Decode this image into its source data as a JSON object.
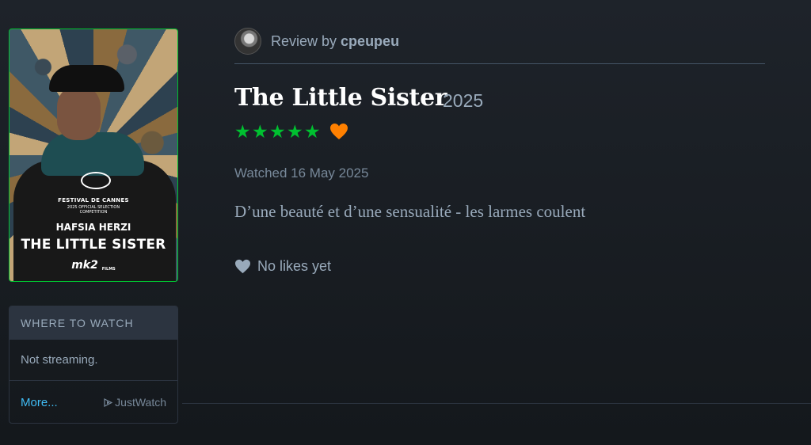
{
  "poster": {
    "festival": "FESTIVAL DE CANNES",
    "selection": "2025 OFFICIAL SELECTION",
    "competition": "COMPETITION",
    "director": "HAFSIA HERZI",
    "title": "THE LITTLE SISTER",
    "distributor": "mk2",
    "distributor_sub": "FILMS"
  },
  "where_to_watch": {
    "heading": "Where to watch",
    "status": "Not streaming.",
    "more_label": "More...",
    "provider": "JustWatch"
  },
  "review": {
    "by_prefix": "Review by",
    "username": "cpeupeu",
    "film_title": "The Little Sister",
    "year": "2025",
    "stars": "★★★★★",
    "liked": true,
    "watched": "Watched 16 May 2025",
    "text": "D’une beauté et d’une sensualité - les larmes coulent",
    "likes_label": "No likes yet"
  },
  "colors": {
    "star_green": "#00c030",
    "heart_orange": "#ff8000",
    "link_blue": "#40bcf4",
    "background": "#14181c"
  },
  "icons": [
    "avatar",
    "star-icon",
    "heart-icon",
    "justwatch-play-icon",
    "like-heart-icon"
  ]
}
